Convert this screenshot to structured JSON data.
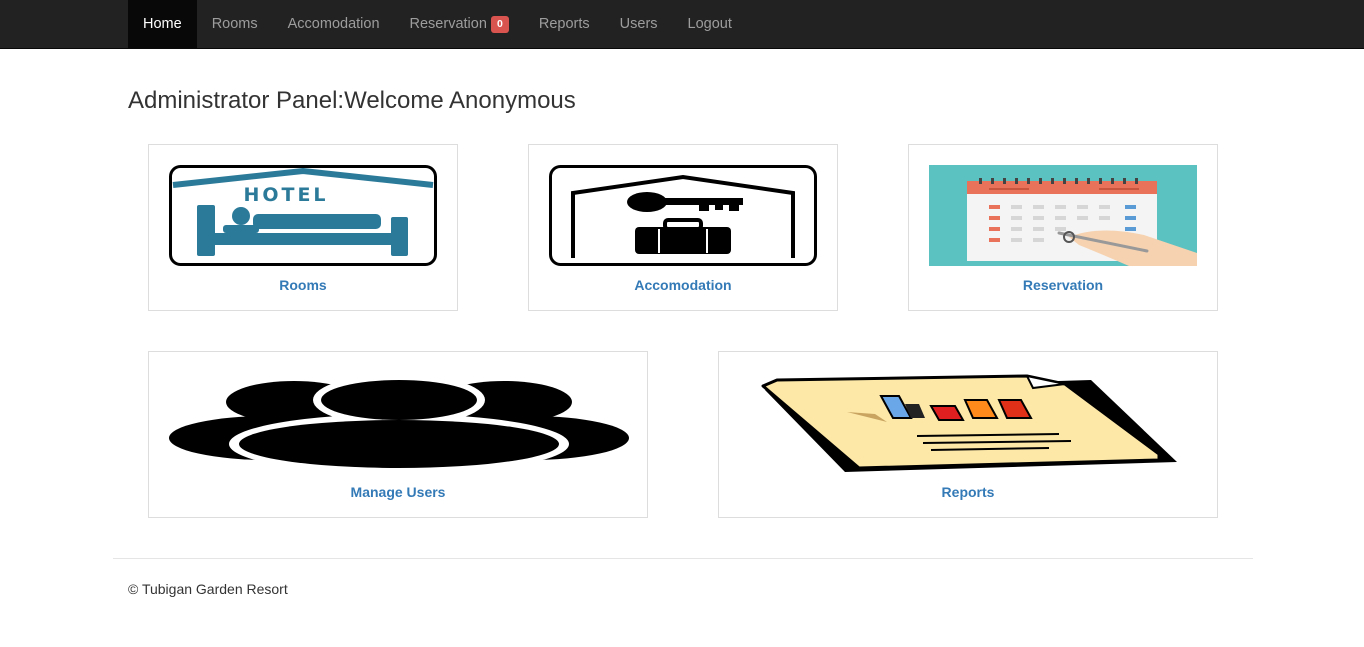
{
  "nav": {
    "items": [
      {
        "label": "Home",
        "active": true
      },
      {
        "label": "Rooms"
      },
      {
        "label": "Accomodation"
      },
      {
        "label": "Reservation",
        "badge": "0"
      },
      {
        "label": "Reports"
      },
      {
        "label": "Users"
      },
      {
        "label": "Logout"
      }
    ]
  },
  "page": {
    "title": "Administrator Panel:Welcome Anonymous"
  },
  "cards": {
    "rooms": {
      "label": "Rooms",
      "image_text": "HOTEL",
      "icon": "hotel-bed-icon"
    },
    "accomodation": {
      "label": "Accomodation",
      "icon": "key-luggage-icon"
    },
    "reservation": {
      "label": "Reservation",
      "icon": "calendar-icon"
    },
    "users": {
      "label": "Manage Users",
      "icon": "users-group-icon"
    },
    "reports": {
      "label": "Reports",
      "icon": "report-chart-icon"
    }
  },
  "footer": {
    "text": "© Tubigan Garden Resort"
  },
  "colors": {
    "navbar": "#222222",
    "link": "#337ab7",
    "badge": "#d9534f",
    "hotel_blue": "#2b7a99",
    "calendar_bg": "#5bc1c1"
  }
}
